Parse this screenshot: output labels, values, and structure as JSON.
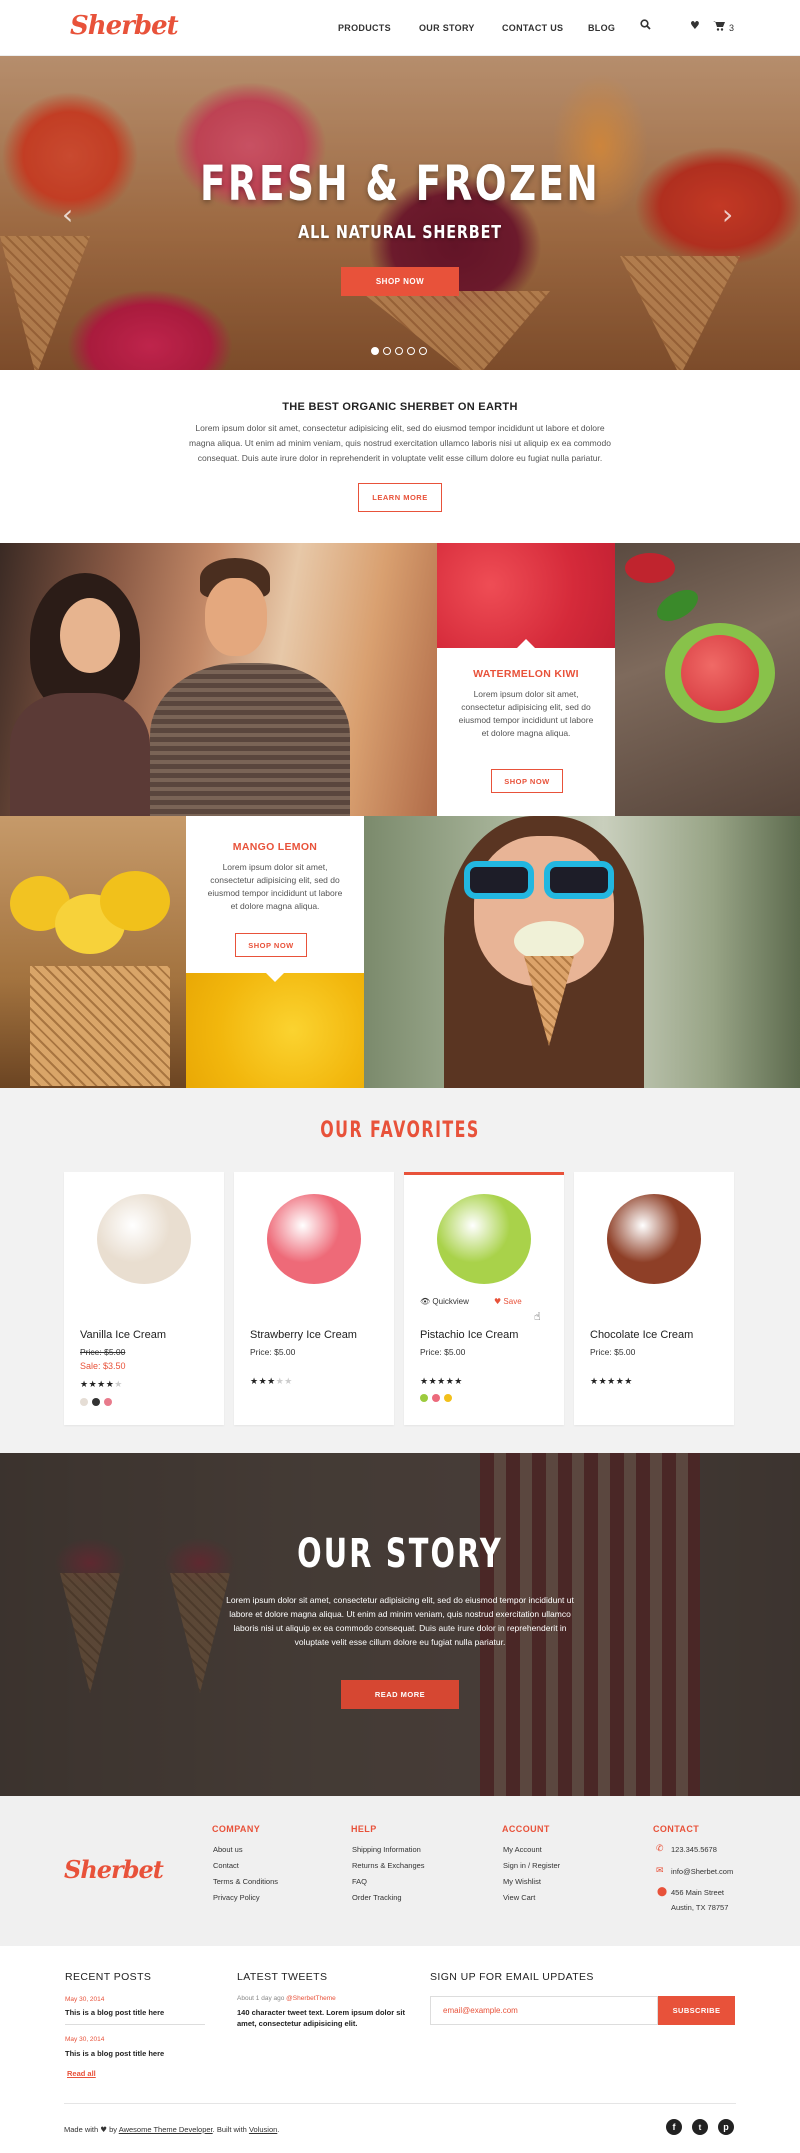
{
  "brand": "Sherbet",
  "nav": {
    "products": "PRODUCTS",
    "story": "OUR STORY",
    "contact": "CONTACT US",
    "blog": "BLOG",
    "cart_count": "3"
  },
  "hero": {
    "title": "FRESH & FROZEN",
    "subtitle": "ALL NATURAL SHERBET",
    "button": "SHOP NOW",
    "slides": 5,
    "active_slide": 1
  },
  "intro": {
    "title": "THE BEST ORGANIC SHERBET ON EARTH",
    "text": "Lorem ipsum dolor sit amet, consectetur adipisicing elit, sed do eiusmod tempor incididunt ut labore et dolore magna aliqua. Ut enim ad minim veniam, quis nostrud exercitation ullamco laboris nisi ut aliquip ex ea commodo consequat. Duis aute irure dolor in reprehenderit in voluptate velit esse cillum dolore eu fugiat nulla pariatur.",
    "button": "LEARN MORE"
  },
  "promo1": {
    "title": "WATERMELON KIWI",
    "text": "Lorem ipsum dolor sit amet, consectetur adipisicing elit, sed do eiusmod tempor incididunt ut labore et dolore magna aliqua.",
    "button": "SHOP NOW"
  },
  "promo2": {
    "title": "MANGO LEMON",
    "text": "Lorem ipsum dolor sit amet, consectetur adipisicing elit, sed do eiusmod tempor incididunt ut labore et dolore magna aliqua.",
    "button": "SHOP NOW"
  },
  "favorites": {
    "title": "OUR FAVORITES",
    "quickview": "Quickview",
    "save": "Save",
    "products": [
      {
        "name": "Vanilla Ice Cream",
        "price": "Price: $5.00",
        "sale": "Sale: $3.50",
        "rating": 4,
        "color": "#e9ded0",
        "swatches": [
          "#e5ddd5",
          "#333333",
          "#e87b8c"
        ]
      },
      {
        "name": "Strawberry Ice Cream",
        "price": "Price: $5.00",
        "rating": 3,
        "color": "#ee6a78"
      },
      {
        "name": "Pistachio Ice Cream",
        "price": "Price: $5.00",
        "rating": 5,
        "color": "#a9d24a",
        "swatches": [
          "#9ccb3e",
          "#ec6a7c",
          "#f2c01b"
        ]
      },
      {
        "name": "Chocolate Ice Cream",
        "price": "Price: $5.00",
        "rating": 5,
        "color": "#8e3f27"
      }
    ]
  },
  "story": {
    "title": "OUR STORY",
    "text": "Lorem ipsum dolor sit amet, consectetur adipisicing elit, sed do eiusmod tempor incididunt ut labore et dolore magna aliqua. Ut enim ad minim veniam, quis nostrud exercitation ullamco laboris nisi ut aliquip ex ea commodo consequat. Duis aute irure dolor in reprehenderit in voluptate velit esse cillum dolore eu fugiat nulla pariatur.",
    "button": "READ MORE"
  },
  "footer": {
    "company": {
      "title": "COMPANY",
      "links": [
        "About us",
        "Contact",
        "Terms & Conditions",
        "Privacy Policy"
      ]
    },
    "help": {
      "title": "HELP",
      "links": [
        "Shipping Information",
        "Returns & Exchanges",
        "FAQ",
        "Order Tracking"
      ]
    },
    "account": {
      "title": "ACCOUNT",
      "links": [
        "My Account",
        "Sign in / Register",
        "My Wishlist",
        "View Cart"
      ]
    },
    "contact": {
      "title": "CONTACT",
      "phone": "123.345.5678",
      "email": "info@Sherbet.com",
      "address1": "456 Main Street",
      "address2": "Austin, TX 78757"
    }
  },
  "bottom": {
    "recent": {
      "title": "RECENT POSTS",
      "posts": [
        {
          "date": "May 30, 2014",
          "title": "This is a blog post title here"
        },
        {
          "date": "May 30, 2014",
          "title": "This is a blog post title here"
        }
      ],
      "read_all": "Read all"
    },
    "tweets": {
      "title": "LATEST TWEETS",
      "meta": "About 1 day ago",
      "handle": "@SherbetTheme",
      "text": "140 character tweet text. Lorem ipsum dolor sit amet, consectetur adipisicing elit."
    },
    "signup": {
      "title": "SIGN UP FOR EMAIL UPDATES",
      "placeholder": "email@example.com",
      "button": "SUBSCRIBE"
    }
  },
  "copyright": {
    "made": "Made with",
    "by": "by",
    "author": "Awesome Theme Developer",
    "built": ". Built with",
    "tool": "Volusion",
    "end": "."
  },
  "colors": {
    "accent": "#e8523a"
  }
}
